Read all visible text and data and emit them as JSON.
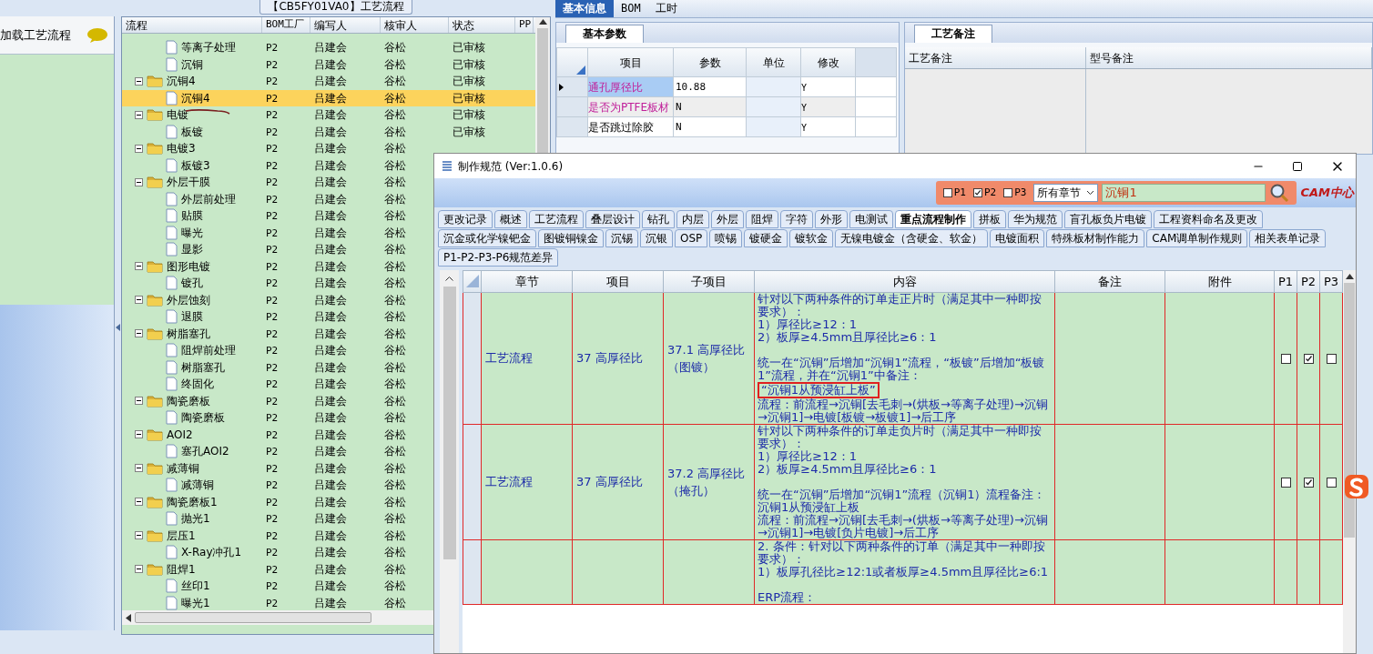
{
  "left_panel": {
    "title": "加载工艺流程"
  },
  "flow_panel": {
    "title": "【CB5FY01VA0】工艺流程",
    "columns": [
      "流程",
      "BOM工厂",
      "编写人",
      "核审人",
      "状态",
      "PP"
    ],
    "tree": [
      {
        "children": [
          {
            "label": "等离子处理",
            "kind": "file",
            "bom": "P2",
            "author": "吕建会",
            "reviewer": "谷松",
            "status": "已审核",
            "selected": false
          },
          {
            "label": "沉铜",
            "kind": "file",
            "bom": "P2",
            "author": "吕建会",
            "reviewer": "谷松",
            "status": "已审核",
            "selected": false
          }
        ]
      },
      {
        "label": "沉铜4",
        "kind": "folder",
        "bom": "P2",
        "author": "吕建会",
        "reviewer": "谷松",
        "status": "已审核",
        "selected": false,
        "children": [
          {
            "label": "沉铜4",
            "kind": "file",
            "bom": "P2",
            "author": "吕建会",
            "reviewer": "谷松",
            "status": "已审核",
            "selected": true
          }
        ]
      },
      {
        "label": "电镀",
        "kind": "folder",
        "bom": "P2",
        "author": "吕建会",
        "reviewer": "谷松",
        "status": "已审核",
        "selected": false,
        "children": [
          {
            "label": "板镀",
            "kind": "file",
            "bom": "P2",
            "author": "吕建会",
            "reviewer": "谷松",
            "status": "已审核",
            "selected": false
          }
        ]
      },
      {
        "label": "电镀3",
        "kind": "folder",
        "bom": "P2",
        "author": "吕建会",
        "reviewer": "谷松",
        "selected": false,
        "children": [
          {
            "label": "板镀3",
            "kind": "file",
            "bom": "P2",
            "author": "吕建会",
            "reviewer": "谷松",
            "selected": false
          }
        ]
      },
      {
        "label": "外层干膜",
        "kind": "folder",
        "bom": "P2",
        "author": "吕建会",
        "reviewer": "谷松",
        "selected": false,
        "children": [
          {
            "label": "外层前处理",
            "kind": "file",
            "bom": "P2",
            "author": "吕建会",
            "reviewer": "谷松",
            "selected": false
          },
          {
            "label": "贴膜",
            "kind": "file",
            "bom": "P2",
            "author": "吕建会",
            "reviewer": "谷松",
            "selected": false
          },
          {
            "label": "曝光",
            "kind": "file",
            "bom": "P2",
            "author": "吕建会",
            "reviewer": "谷松",
            "selected": false
          },
          {
            "label": "显影",
            "kind": "file",
            "bom": "P2",
            "author": "吕建会",
            "reviewer": "谷松",
            "selected": false
          }
        ]
      },
      {
        "label": "图形电镀",
        "kind": "folder",
        "bom": "P2",
        "author": "吕建会",
        "reviewer": "谷松",
        "selected": false,
        "children": [
          {
            "label": "镀孔",
            "kind": "file",
            "bom": "P2",
            "author": "吕建会",
            "reviewer": "谷松",
            "selected": false
          }
        ]
      },
      {
        "label": "外层蚀刻",
        "kind": "folder",
        "bom": "P2",
        "author": "吕建会",
        "reviewer": "谷松",
        "selected": false,
        "children": [
          {
            "label": "退膜",
            "kind": "file",
            "bom": "P2",
            "author": "吕建会",
            "reviewer": "谷松",
            "selected": false
          }
        ]
      },
      {
        "label": "树脂塞孔",
        "kind": "folder",
        "bom": "P2",
        "author": "吕建会",
        "reviewer": "谷松",
        "selected": false,
        "children": [
          {
            "label": "阻焊前处理",
            "kind": "file",
            "bom": "P2",
            "author": "吕建会",
            "reviewer": "谷松",
            "selected": false
          },
          {
            "label": "树脂塞孔",
            "kind": "file",
            "bom": "P2",
            "author": "吕建会",
            "reviewer": "谷松",
            "selected": false
          },
          {
            "label": "终固化",
            "kind": "file",
            "bom": "P2",
            "author": "吕建会",
            "reviewer": "谷松",
            "selected": false
          }
        ]
      },
      {
        "label": "陶瓷磨板",
        "kind": "folder",
        "bom": "P2",
        "author": "吕建会",
        "reviewer": "谷松",
        "selected": false,
        "children": [
          {
            "label": "陶瓷磨板",
            "kind": "file",
            "bom": "P2",
            "author": "吕建会",
            "reviewer": "谷松",
            "selected": false
          }
        ]
      },
      {
        "label": "AOI2",
        "kind": "folder",
        "bom": "P2",
        "author": "吕建会",
        "reviewer": "谷松",
        "selected": false,
        "children": [
          {
            "label": "塞孔AOI2",
            "kind": "file",
            "bom": "P2",
            "author": "吕建会",
            "reviewer": "谷松",
            "selected": false
          }
        ]
      },
      {
        "label": "减薄铜",
        "kind": "folder",
        "bom": "P2",
        "author": "吕建会",
        "reviewer": "谷松",
        "selected": false,
        "children": [
          {
            "label": "减薄铜",
            "kind": "file",
            "bom": "P2",
            "author": "吕建会",
            "reviewer": "谷松",
            "selected": false
          }
        ]
      },
      {
        "label": "陶瓷磨板1",
        "kind": "folder",
        "bom": "P2",
        "author": "吕建会",
        "reviewer": "谷松",
        "selected": false,
        "children": [
          {
            "label": "抛光1",
            "kind": "file",
            "bom": "P2",
            "author": "吕建会",
            "reviewer": "谷松",
            "selected": false
          }
        ]
      },
      {
        "label": "层压1",
        "kind": "folder",
        "bom": "P2",
        "author": "吕建会",
        "reviewer": "谷松",
        "selected": false,
        "children": [
          {
            "label": "X-Ray冲孔1",
            "kind": "file",
            "bom": "P2",
            "author": "吕建会",
            "reviewer": "谷松",
            "selected": false
          }
        ]
      },
      {
        "label": "阻焊1",
        "kind": "folder",
        "bom": "P2",
        "author": "吕建会",
        "reviewer": "谷松",
        "selected": false,
        "children": [
          {
            "label": "丝印1",
            "kind": "file",
            "bom": "P2",
            "author": "吕建会",
            "reviewer": "谷松",
            "selected": false
          },
          {
            "label": "曝光1",
            "kind": "file",
            "bom": "P2",
            "author": "吕建会",
            "reviewer": "谷松",
            "selected": false
          }
        ]
      }
    ]
  },
  "right_tabs": [
    {
      "label": "基本信息",
      "selected": true
    },
    {
      "label": "BOM",
      "selected": false
    },
    {
      "label": "工时",
      "selected": false
    }
  ],
  "params_panel": {
    "tab": "基本参数",
    "columns": [
      "项目",
      "参数",
      "单位",
      "修改"
    ],
    "rows": [
      {
        "item": "通孔厚径比",
        "value": "10.88",
        "modify": "Y",
        "emphasized": true,
        "selected": true
      },
      {
        "item": "是否为PTFE板材",
        "value": "N",
        "modify": "Y",
        "emphasized": true,
        "selected": false
      },
      {
        "item": "是否跳过除胶",
        "value": "N",
        "modify": "Y",
        "emphasized": false,
        "selected": false
      }
    ]
  },
  "notes_panel": {
    "tab": "工艺备注",
    "columns": [
      "工艺备注",
      "型号备注"
    ]
  },
  "dialog": {
    "title": "制作规范 (Ver:1.0.6)",
    "filters": [
      {
        "label": "P1",
        "checked": false
      },
      {
        "label": "P2",
        "checked": true
      },
      {
        "label": "P3",
        "checked": false
      }
    ],
    "chapter_select": "所有章节",
    "search_value": "沉铜1",
    "logo": "CAM中心",
    "tab_rows": [
      [
        {
          "label": "更改记录",
          "selected": false
        },
        {
          "label": "概述",
          "selected": false
        },
        {
          "label": "工艺流程",
          "selected": false
        },
        {
          "label": "叠层设计",
          "selected": false
        },
        {
          "label": "钻孔",
          "selected": false
        },
        {
          "label": "内层",
          "selected": false
        },
        {
          "label": "外层",
          "selected": false
        },
        {
          "label": "阻焊",
          "selected": false
        },
        {
          "label": "字符",
          "selected": false
        },
        {
          "label": "外形",
          "selected": false
        },
        {
          "label": "电测试",
          "selected": false
        },
        {
          "label": "重点流程制作",
          "selected": true
        },
        {
          "label": "拼板",
          "selected": false
        },
        {
          "label": "华为规范",
          "selected": false
        },
        {
          "label": "盲孔板负片电镀",
          "selected": false
        },
        {
          "label": "工程资料命名及更改",
          "selected": false
        }
      ],
      [
        {
          "label": "沉金或化学镍钯金",
          "selected": false
        },
        {
          "label": "图镀铜镍金",
          "selected": false
        },
        {
          "label": "沉锡",
          "selected": false
        },
        {
          "label": "沉银",
          "selected": false
        },
        {
          "label": "OSP",
          "selected": false
        },
        {
          "label": "喷锡",
          "selected": false
        },
        {
          "label": "镀硬金",
          "selected": false
        },
        {
          "label": "镀软金",
          "selected": false
        },
        {
          "label": "无镍电镀金（含硬金、软金）",
          "selected": false
        },
        {
          "label": "电镀面积",
          "selected": false
        },
        {
          "label": "特殊板材制作能力",
          "selected": false
        },
        {
          "label": "CAM调单制作规则",
          "selected": false
        },
        {
          "label": "相关表单记录",
          "selected": false
        }
      ],
      [
        {
          "label": "P1-P2-P3-P6规范差异",
          "selected": false
        }
      ]
    ],
    "columns": [
      "章节",
      "项目",
      "子项目",
      "内容",
      "备注",
      "附件",
      "P1",
      "P2",
      "P3"
    ],
    "rows": [
      {
        "chapter": "工艺流程",
        "item": "37 高厚径比",
        "sub_item": "37.1 高厚径比（图镀）",
        "content": [
          [
            {
              "text": "针对以下两种条件的订单走正片时（满足其中一种即按要求）：",
              "boxed": false
            },
            {
              "text": "1）厚径比≥12：1",
              "boxed": false
            },
            {
              "text": "2）板厚≥4.5mm且厚径比≥6：1",
              "boxed": false
            }
          ],
          [
            {
              "text": "统一在“沉铜”后增加“沉铜1”流程，“板镀”后增加“板镀1”流程，并在“沉铜1”中备注：",
              "boxed": false
            },
            {
              "text": "“沉铜1从预浸缸上板”",
              "boxed": true
            },
            {
              "text": "流程：前流程→沉铜[去毛刺→(烘板→等离子处理)→沉铜→沉铜1]→电镀[板镀→板镀1]→后工序",
              "boxed": false
            }
          ]
        ],
        "flags": [
          {
            "checked": false
          },
          {
            "checked": true
          },
          {
            "checked": false
          }
        ]
      },
      {
        "chapter": "工艺流程",
        "item": "37 高厚径比",
        "sub_item": "37.2 高厚径比（掩孔）",
        "content": [
          [
            {
              "text": "针对以下两种条件的订单走负片时（满足其中一种即按要求）：",
              "boxed": false
            },
            {
              "text": "1）厚径比≥12：1",
              "boxed": false
            },
            {
              "text": "2）板厚≥4.5mm且厚径比≥6：1",
              "boxed": false
            }
          ],
          [
            {
              "text": "统一在“沉铜”后增加“沉铜1”流程（沉铜1）流程备注：沉铜1从预浸缸上板",
              "boxed": false
            },
            {
              "text": "流程：前流程→沉铜[去毛刺→(烘板→等离子处理)→沉铜→沉铜1]→电镀[负片电镀]→后工序",
              "boxed": false
            }
          ]
        ],
        "flags": [
          {
            "checked": false
          },
          {
            "checked": true
          },
          {
            "checked": false
          }
        ]
      },
      {
        "content": [
          [
            {
              "text": "2. 条件：针对以下两种条件的订单（满足其中一种即按要求）：",
              "boxed": false
            },
            {
              "text": "1）板厚孔径比≥12:1或者板厚≥4.5mm且厚径比≥6:1",
              "boxed": false
            }
          ],
          [
            {
              "text": "ERP流程：",
              "boxed": false
            }
          ]
        ]
      }
    ]
  }
}
